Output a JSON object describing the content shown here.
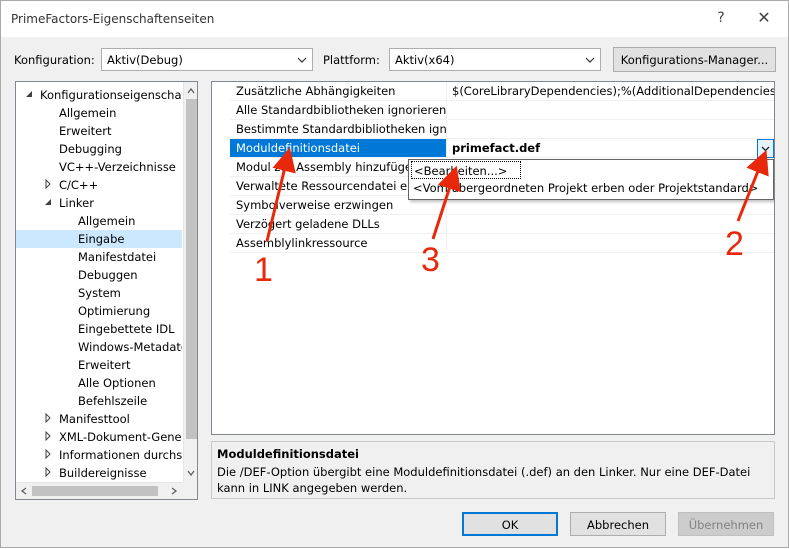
{
  "window": {
    "title": "PrimeFactors-Eigenschaftenseiten",
    "help_glyph": "?",
    "close_glyph": "✕"
  },
  "toolbar": {
    "config_label": "Konfiguration:",
    "config_value": "Aktiv(Debug)",
    "platform_label": "Plattform:",
    "platform_value": "Aktiv(x64)",
    "manager_button": "Konfigurations-Manager..."
  },
  "tree": {
    "items": [
      {
        "label": "Konfigurationseigenschaften",
        "level": 0,
        "expander": "expanded"
      },
      {
        "label": "Allgemein",
        "level": 1,
        "expander": "none"
      },
      {
        "label": "Erweitert",
        "level": 1,
        "expander": "none"
      },
      {
        "label": "Debugging",
        "level": 1,
        "expander": "none"
      },
      {
        "label": "VC++-Verzeichnisse",
        "level": 1,
        "expander": "none"
      },
      {
        "label": "C/C++",
        "level": 1,
        "expander": "collapsed"
      },
      {
        "label": "Linker",
        "level": 1,
        "expander": "expanded"
      },
      {
        "label": "Allgemein",
        "level": 2,
        "expander": "none"
      },
      {
        "label": "Eingabe",
        "level": 2,
        "expander": "none",
        "selected": true
      },
      {
        "label": "Manifestdatei",
        "level": 2,
        "expander": "none"
      },
      {
        "label": "Debuggen",
        "level": 2,
        "expander": "none"
      },
      {
        "label": "System",
        "level": 2,
        "expander": "none"
      },
      {
        "label": "Optimierung",
        "level": 2,
        "expander": "none"
      },
      {
        "label": "Eingebettete IDL",
        "level": 2,
        "expander": "none"
      },
      {
        "label": "Windows-Metadaten",
        "level": 2,
        "expander": "none"
      },
      {
        "label": "Erweitert",
        "level": 2,
        "expander": "none"
      },
      {
        "label": "Alle Optionen",
        "level": 2,
        "expander": "none"
      },
      {
        "label": "Befehlszeile",
        "level": 2,
        "expander": "none"
      },
      {
        "label": "Manifesttool",
        "level": 1,
        "expander": "collapsed"
      },
      {
        "label": "XML-Dokument-Generator",
        "level": 1,
        "expander": "collapsed"
      },
      {
        "label": "Informationen durchsuchen",
        "level": 1,
        "expander": "collapsed"
      },
      {
        "label": "Buildereignisse",
        "level": 1,
        "expander": "collapsed"
      }
    ]
  },
  "grid": {
    "rows": [
      {
        "name": "Zusätzliche Abhängigkeiten",
        "value": "$(CoreLibraryDependencies);%(AdditionalDependencies)"
      },
      {
        "name": "Alle Standardbibliotheken ignorieren",
        "value": ""
      },
      {
        "name": "Bestimmte Standardbibliotheken ignorieren",
        "value": ""
      },
      {
        "name": "Moduldefinitionsdatei",
        "value": "primefact.def",
        "selected": true
      },
      {
        "name": "Modul zur Assembly hinzufügen",
        "value": ""
      },
      {
        "name": "Verwaltete Ressourcendatei einbetten",
        "value": ""
      },
      {
        "name": "Symbolverweise erzwingen",
        "value": ""
      },
      {
        "name": "Verzögert geladene DLLs",
        "value": ""
      },
      {
        "name": "Assemblylinkressource",
        "value": ""
      }
    ],
    "dropdown_options": [
      "<Bearbeiten...>",
      "<Vom übergeordneten Projekt erben oder Projektstandard>"
    ]
  },
  "description": {
    "title": "Moduldefinitionsdatei",
    "text": "Die /DEF-Option übergibt eine Moduldefinitionsdatei (.def) an den Linker. Nur eine DEF-Datei kann in LINK angegeben werden."
  },
  "buttons": {
    "ok": "OK",
    "cancel": "Abbrechen",
    "apply": "Übernehmen"
  },
  "annotations": {
    "labels": [
      "1",
      "2",
      "3"
    ]
  },
  "colors": {
    "selection": "#0078d7",
    "tree_selection": "#cce8ff",
    "annotation": "#e8280a"
  }
}
